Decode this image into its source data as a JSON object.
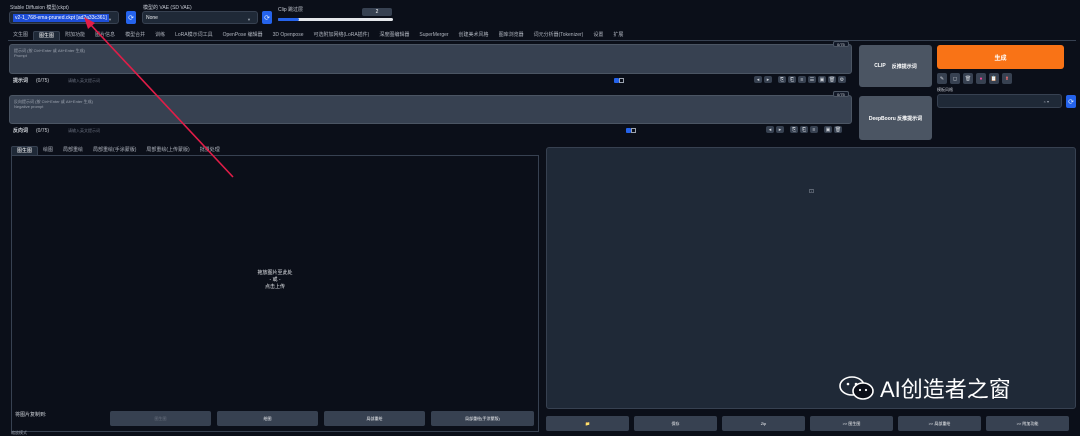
{
  "model": {
    "label": "Stable Diffusion 模型(ckpt)",
    "value": "v2-1_768-ema-pruned.ckpt [ad2a33c361]"
  },
  "vae": {
    "label": "模型的 VAE (SD VAE)",
    "value": "None"
  },
  "clip": {
    "label": "Clip 跳过层",
    "value": "2",
    "fraction": 0.18
  },
  "tabs": [
    "文生图",
    "图生图",
    "附加功能",
    "图片信息",
    "模型合并",
    "训练",
    "LoRA模示词工具",
    "OpenPose 编辑器",
    "3D Openpose",
    "可选附加网络(LoRA插件)",
    "深度图编辑器",
    "SuperMerger",
    "创建美术风格",
    "图库浏览器",
    "词元分析器(Tokenizer)",
    "设置",
    "扩展"
  ],
  "prompt": {
    "label": "提示词",
    "hint": "(按 Ctrl+Enter 或 Alt+Enter 生成)",
    "placeholder": "Prompt",
    "count": "0/75",
    "emb_label": "提示词",
    "emb_count": "(0/75)",
    "input_placeholder": "请输入英文提示词"
  },
  "neg": {
    "label": "反向提示词",
    "hint": "(按 Ctrl+Enter 或 Alt+Enter 生成)",
    "placeholder": "Negative prompt",
    "count": "0/75",
    "emb_label": "反向词",
    "emb_count": "(0/75)",
    "input_placeholder": "请输入英文提示词"
  },
  "interrogate": {
    "clip": "CLIP",
    "clip2": "反推提示词",
    "deepbooru": "DeepBooru 反推提示词"
  },
  "generate": {
    "label": "生成",
    "accent": "#f97316"
  },
  "style": {
    "label": "模板风格"
  },
  "subtabs": [
    "图生图",
    "绘图",
    "局部重绘",
    "局部重绘(手涂蒙版)",
    "局部重绘(上传蒙版)",
    "批量处理"
  ],
  "upload": {
    "line1": "拖放图片至此处",
    "line2": "- 或 -",
    "line3": "点击上传"
  },
  "copyto": {
    "label": "将图片复制到:",
    "buttons": [
      "图生图",
      "绘图",
      "局部重绘",
      "局部重绘(手涂蒙版)"
    ]
  },
  "output_buttons": [
    "📁",
    "保存",
    "Zip",
    ">> 图生图",
    ">> 局部重绘",
    ">> 附加功能"
  ],
  "resize_label": "缩放模式",
  "watermark": "AI创造者之窗",
  "colors": {
    "bg": "#0b0f19",
    "panel": "#1f2937",
    "accent": "#f97316",
    "blue": "#2563eb",
    "arrow": "#e11d48"
  }
}
